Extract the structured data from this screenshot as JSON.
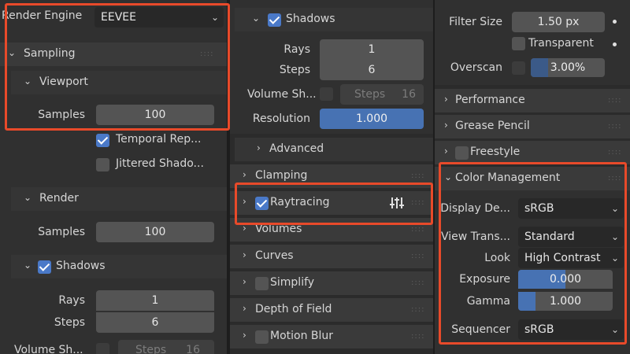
{
  "render_engine": {
    "label": "Render Engine",
    "value": "EEVEE"
  },
  "sampling": {
    "title": "Sampling",
    "viewport": {
      "title": "Viewport",
      "samples_label": "Samples",
      "samples": "100",
      "temporal_label": "Temporal Rep...",
      "jittered_label": "Jittered Shado..."
    },
    "render": {
      "title": "Render",
      "samples_label": "Samples",
      "samples": "100"
    },
    "shadows": {
      "title": "Shadows",
      "rays_label": "Rays",
      "rays": "1",
      "steps_label": "Steps",
      "steps": "6",
      "volume_label": "Volume Sh...",
      "volume_steps_label": "Steps",
      "volume_steps": "16"
    }
  },
  "middle": {
    "shadows": {
      "title": "Shadows",
      "rays_label": "Rays",
      "rays": "1",
      "steps_label": "Steps",
      "steps": "6",
      "volume_label": "Volume Sh...",
      "volume_steps_label": "Steps",
      "volume_steps": "16",
      "resolution_label": "Resolution",
      "resolution": "1.000",
      "advanced": "Advanced"
    },
    "panels": [
      "Clamping",
      "Raytracing",
      "Volumes",
      "Curves",
      "Simplify",
      "Depth of Field",
      "Motion Blur"
    ]
  },
  "right": {
    "filter_size_label": "Filter Size",
    "filter_size": "1.50 px",
    "transparent_label": "Transparent",
    "overscan_label": "Overscan",
    "overscan": "3.00%",
    "panels": [
      "Performance",
      "Grease Pencil",
      "Freestyle"
    ],
    "color_management": {
      "title": "Color Management",
      "display_label": "Display De...",
      "display": "sRGB",
      "view_label": "View Trans...",
      "view": "Standard",
      "look_label": "Look",
      "look": "High Contrast",
      "exposure_label": "Exposure",
      "exposure": "0.000",
      "exposure_fill": 0.5,
      "gamma_label": "Gamma",
      "gamma": "1.000",
      "gamma_fill": 0.18,
      "sequencer_label": "Sequencer",
      "sequencer": "sRGB"
    }
  },
  "colors": {
    "highlight": "#e84a2a",
    "accent": "#4772b3"
  }
}
